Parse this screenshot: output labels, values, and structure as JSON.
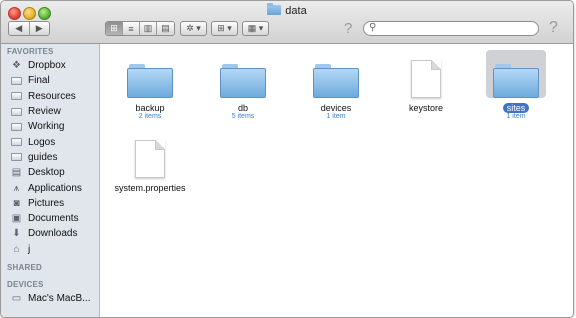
{
  "window": {
    "title": "data"
  },
  "toolbar": {
    "back_glyph": "◀",
    "forward_glyph": "▶",
    "view_modes": [
      "⊞",
      "≡",
      "▥",
      "▤"
    ],
    "active_view": 0,
    "action_menu": "✲ ▾",
    "arrange_menu": "⊞ ▾",
    "share_menu": "▦ ▾",
    "help_glyph": "?",
    "search": {
      "placeholder": "",
      "icon": "magnifier-icon"
    },
    "help_glyph_outer": "?"
  },
  "sidebar": {
    "favorites_header": "FAVORITES",
    "favorites": [
      {
        "label": "Dropbox",
        "icon": "dropbox-icon"
      },
      {
        "label": "Final",
        "icon": "folder-icon"
      },
      {
        "label": "Resources",
        "icon": "folder-icon"
      },
      {
        "label": "Review",
        "icon": "folder-icon"
      },
      {
        "label": "Working",
        "icon": "folder-icon"
      },
      {
        "label": "Logos",
        "icon": "folder-icon"
      },
      {
        "label": "guides",
        "icon": "folder-icon"
      },
      {
        "label": "Desktop",
        "icon": "desktop-icon"
      },
      {
        "label": "Applications",
        "icon": "applications-icon"
      },
      {
        "label": "Pictures",
        "icon": "camera-icon"
      },
      {
        "label": "Documents",
        "icon": "documents-icon"
      },
      {
        "label": "Downloads",
        "icon": "download-icon"
      },
      {
        "label": "j",
        "icon": "home-icon"
      }
    ],
    "shared_header": "SHARED",
    "devices_header": "DEVICES",
    "devices": [
      {
        "label": "Mac's MacB...",
        "icon": "laptop-icon"
      }
    ]
  },
  "files": [
    {
      "name": "backup",
      "sub": "2 items",
      "type": "folder",
      "selected": false
    },
    {
      "name": "db",
      "sub": "5 items",
      "type": "folder",
      "selected": false
    },
    {
      "name": "devices",
      "sub": "1 item",
      "type": "folder",
      "selected": false
    },
    {
      "name": "keystore",
      "sub": "",
      "type": "document",
      "selected": false
    },
    {
      "name": "sites",
      "sub": "1 item",
      "type": "folder",
      "selected": true
    },
    {
      "name": "system.properties",
      "sub": "",
      "type": "document",
      "selected": false
    }
  ],
  "colors": {
    "sidebar_bg": "#e1e6ec",
    "selection": "#3e73c8",
    "item_count": "#3f7fcc"
  }
}
